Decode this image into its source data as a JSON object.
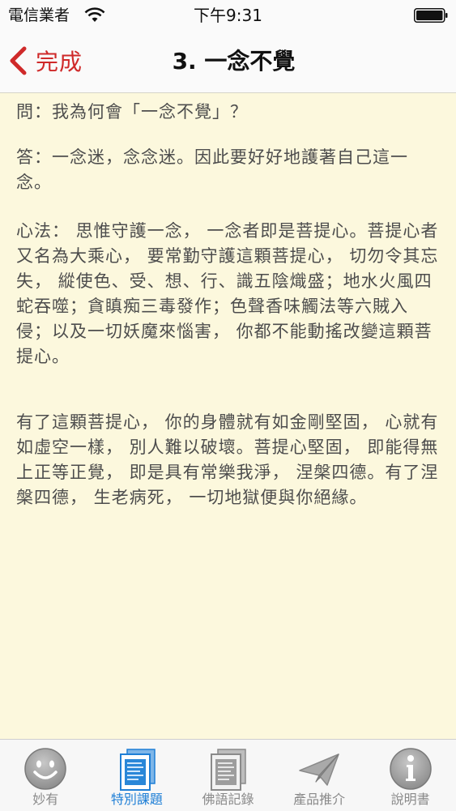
{
  "status_bar": {
    "carrier": "電信業者",
    "time": "下午9:31"
  },
  "nav": {
    "back_label": "完成",
    "title": "3. 一念不覺"
  },
  "content": {
    "paragraphs": [
      "問：我為何會「一念不覺」？",
      "答：一念迷，念念迷。因此要好好地護著自己這一念。",
      "心法： 思惟守護一念， 一念者即是菩提心。菩提心者又名為大乘心， 要常勤守護這顆菩提心， 切勿令其忘失， 縱使色、受、想、行、識五陰熾盛；地水火風四蛇吞噬；貪瞋痴三毒發作；色聲香味觸法等六賊入侵；以及一切妖魔來惱害， 你都不能動搖改變這顆菩提心。",
      "有了這顆菩提心， 你的身體就有如金剛堅固， 心就有如虛空一樣， 別人難以破壞。菩提心堅固， 即能得無上正等正覺， 即是具有常樂我淨， 涅槃四德。有了涅槃四德， 生老病死， 一切地獄便與你絕緣。"
    ]
  },
  "tabs": [
    {
      "label": "妙有",
      "icon": "smiley-icon",
      "active": false
    },
    {
      "label": "特別課題",
      "icon": "document-icon",
      "active": true
    },
    {
      "label": "佛語記錄",
      "icon": "notebook-icon",
      "active": false
    },
    {
      "label": "產品推介",
      "icon": "paper-plane-icon",
      "active": false
    },
    {
      "label": "說明書",
      "icon": "info-icon",
      "active": false
    }
  ],
  "colors": {
    "accent": "#cf2a2a",
    "tab_active": "#1f7fd6",
    "background": "#fcf8dd"
  }
}
